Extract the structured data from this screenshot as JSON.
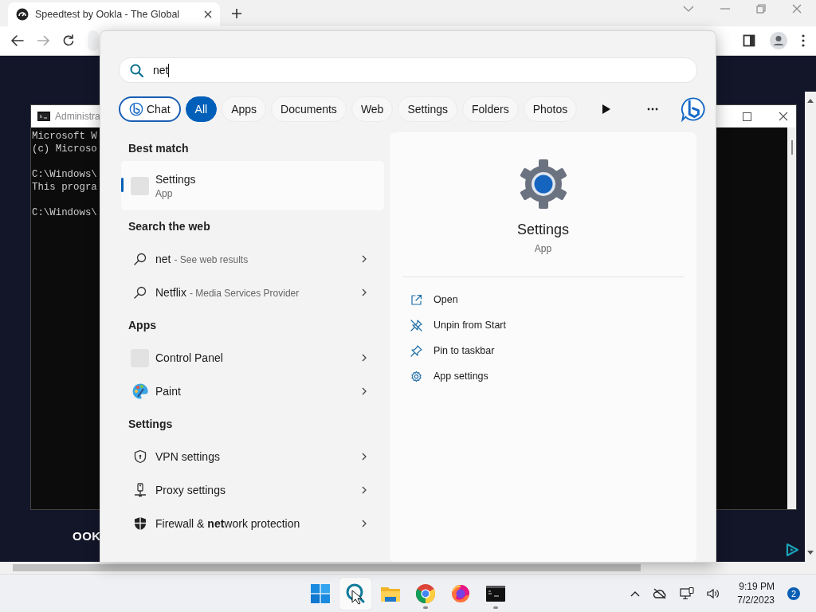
{
  "browser": {
    "tab": {
      "title": "Speedtest by Ookla - The Global"
    }
  },
  "console": {
    "title": "Administra",
    "blocks": [
      {
        "lines": [
          "Microsoft W",
          "(c) Microso"
        ]
      },
      {
        "lines": [
          "C:\\Windows\\",
          "This progra"
        ]
      },
      {
        "lines": [
          "C:\\Windows\\"
        ]
      }
    ]
  },
  "page": {
    "brand_text": "OOK"
  },
  "search": {
    "value": "net",
    "filters": [
      {
        "label": "Chat",
        "kind": "chat",
        "selected": false
      },
      {
        "label": "All",
        "kind": "text",
        "selected": true
      },
      {
        "label": "Apps",
        "kind": "text",
        "selected": false
      },
      {
        "label": "Documents",
        "kind": "text",
        "selected": false
      },
      {
        "label": "Web",
        "kind": "text",
        "selected": false
      },
      {
        "label": "Settings",
        "kind": "text",
        "selected": false
      },
      {
        "label": "Folders",
        "kind": "text",
        "selected": false
      },
      {
        "label": "Photos",
        "kind": "text",
        "selected": false
      }
    ]
  },
  "results": {
    "sections": [
      {
        "heading": "Best match",
        "items": [
          {
            "kind": "app-tile",
            "title": "Settings",
            "subtitle": "App",
            "selected": true
          }
        ]
      },
      {
        "heading": "Search the web",
        "items": [
          {
            "kind": "web",
            "title": "net",
            "subtitle": "- See web results",
            "selected": false
          },
          {
            "kind": "web",
            "title": "Netflix",
            "subtitle": "- Media Services Provider",
            "selected": false
          }
        ]
      },
      {
        "heading": "Apps",
        "items": [
          {
            "kind": "app-tile",
            "title": "Control Panel",
            "selected": false
          },
          {
            "kind": "paint",
            "title": "Paint",
            "selected": false
          }
        ]
      },
      {
        "heading": "Settings",
        "items": [
          {
            "kind": "vpn",
            "title": "VPN settings",
            "selected": false
          },
          {
            "kind": "proxy",
            "title": "Proxy settings",
            "selected": false
          },
          {
            "kind": "firewall",
            "title": "Firewall & **net**work protection",
            "selected": false
          }
        ]
      }
    ]
  },
  "details": {
    "title": "Settings",
    "subtitle": "App",
    "actions": [
      {
        "kind": "open",
        "label": "Open"
      },
      {
        "kind": "unpin",
        "label": "Unpin from Start"
      },
      {
        "kind": "pin",
        "label": "Pin to taskbar"
      },
      {
        "kind": "settings",
        "label": "App settings"
      }
    ]
  },
  "taskbar": {
    "apps": [
      {
        "kind": "start",
        "selected": false,
        "running": false
      },
      {
        "kind": "search",
        "selected": true,
        "running": false
      },
      {
        "kind": "files",
        "selected": false,
        "running": false
      },
      {
        "kind": "chrome",
        "selected": false,
        "running": true
      },
      {
        "kind": "firefox",
        "selected": false,
        "running": false
      },
      {
        "kind": "terminal",
        "selected": false,
        "running": true
      }
    ],
    "clock": {
      "time": "9:19 PM",
      "date": "7/2/2023"
    },
    "notification_count": "2"
  }
}
